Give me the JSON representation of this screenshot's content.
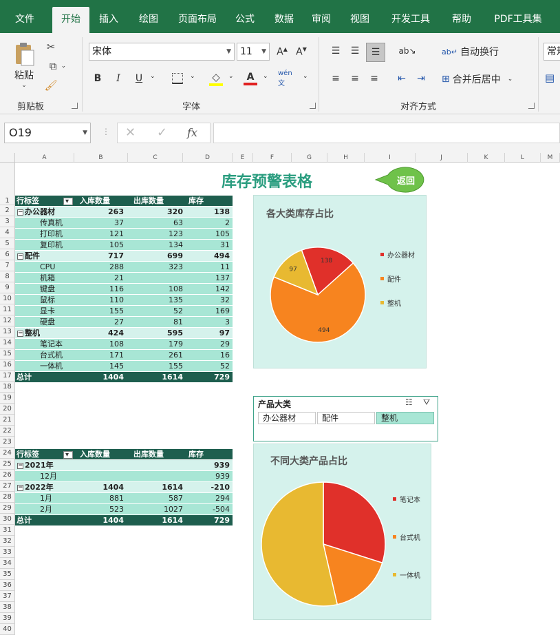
{
  "menu_tabs": [
    "文件",
    "开始",
    "插入",
    "绘图",
    "页面布局",
    "公式",
    "数据",
    "审阅",
    "视图",
    "开发工具",
    "帮助",
    "PDF工具集"
  ],
  "active_tab": "开始",
  "ribbon": {
    "clipboard": {
      "paste_label": "粘贴",
      "group_label": "剪贴板"
    },
    "font": {
      "font_name": "宋体",
      "font_size": "11",
      "group_label": "字体",
      "bold": "B",
      "italic": "I",
      "underline": "U",
      "wen": "wén 文"
    },
    "alignment": {
      "wrap_text": "自动换行",
      "merge_center": "合并后居中",
      "group_label": "对齐方式"
    },
    "number": {
      "format": "常规"
    }
  },
  "formula_bar": {
    "name_box": "O19",
    "fx": "fx",
    "value": ""
  },
  "columns": [
    "A",
    "B",
    "C",
    "D",
    "E",
    "F",
    "G",
    "H",
    "I",
    "J",
    "K",
    "L",
    "M"
  ],
  "rows": [
    "1",
    "2",
    "3",
    "4",
    "5",
    "6",
    "7",
    "8",
    "9",
    "10",
    "11",
    "12",
    "13",
    "14",
    "15",
    "16",
    "17",
    "18",
    "19",
    "20",
    "21",
    "22",
    "23",
    "24",
    "25",
    "26",
    "27",
    "28",
    "29",
    "30",
    "31",
    "32",
    "33",
    "34",
    "35",
    "36",
    "37",
    "38",
    "39",
    "40"
  ],
  "sheet_title": "库存预警表格",
  "back_button": "返回",
  "pivot1": {
    "headers": [
      "行标签",
      "入库数量",
      "出库数量",
      "库存"
    ],
    "rows": [
      {
        "type": "grp",
        "label": "办公器材",
        "in": "263",
        "out": "320",
        "stock": "138"
      },
      {
        "type": "itm",
        "label": "传真机",
        "in": "37",
        "out": "63",
        "stock": "2"
      },
      {
        "type": "itm",
        "label": "打印机",
        "in": "121",
        "out": "123",
        "stock": "105"
      },
      {
        "type": "itm",
        "label": "复印机",
        "in": "105",
        "out": "134",
        "stock": "31"
      },
      {
        "type": "grp",
        "label": "配件",
        "in": "717",
        "out": "699",
        "stock": "494"
      },
      {
        "type": "itm",
        "label": "CPU",
        "in": "288",
        "out": "323",
        "stock": "11"
      },
      {
        "type": "itm",
        "label": "机箱",
        "in": "21",
        "out": "",
        "stock": "137"
      },
      {
        "type": "itm",
        "label": "键盘",
        "in": "116",
        "out": "108",
        "stock": "142"
      },
      {
        "type": "itm",
        "label": "鼠标",
        "in": "110",
        "out": "135",
        "stock": "32"
      },
      {
        "type": "itm",
        "label": "显卡",
        "in": "155",
        "out": "52",
        "stock": "169"
      },
      {
        "type": "itm",
        "label": "硬盘",
        "in": "27",
        "out": "81",
        "stock": "3"
      },
      {
        "type": "grp",
        "label": "整机",
        "in": "424",
        "out": "595",
        "stock": "97"
      },
      {
        "type": "itm",
        "label": "笔记本",
        "in": "108",
        "out": "179",
        "stock": "29"
      },
      {
        "type": "itm",
        "label": "台式机",
        "in": "171",
        "out": "261",
        "stock": "16"
      },
      {
        "type": "itm",
        "label": "一体机",
        "in": "145",
        "out": "155",
        "stock": "52"
      },
      {
        "type": "tot",
        "label": "总计",
        "in": "1404",
        "out": "1614",
        "stock": "729"
      }
    ]
  },
  "pivot2": {
    "headers": [
      "行标签",
      "入库数量",
      "出库数量",
      "库存"
    ],
    "rows": [
      {
        "type": "grp",
        "label": "2021年",
        "in": "",
        "out": "",
        "stock": "939"
      },
      {
        "type": "itm",
        "label": "12月",
        "in": "",
        "out": "",
        "stock": "939"
      },
      {
        "type": "grp",
        "label": "2022年",
        "in": "1404",
        "out": "1614",
        "stock": "-210"
      },
      {
        "type": "itm",
        "label": "1月",
        "in": "881",
        "out": "587",
        "stock": "294"
      },
      {
        "type": "itm",
        "label": "2月",
        "in": "523",
        "out": "1027",
        "stock": "-504"
      },
      {
        "type": "tot",
        "label": "总计",
        "in": "1404",
        "out": "1614",
        "stock": "729"
      }
    ]
  },
  "slicer": {
    "title": "产品大类",
    "items": [
      "办公器材",
      "配件",
      "整机"
    ],
    "selected": "整机"
  },
  "colors": {
    "excel_green": "#217346",
    "pivot_dark": "#1e5e4e",
    "pivot_light": "#d5f2ec",
    "pivot_mid": "#a8e6d5",
    "red": "#e0302a",
    "orange": "#f7841f",
    "gold": "#e8b931"
  },
  "chart_data": [
    {
      "type": "pie",
      "title": "各大类库存占比",
      "categories": [
        "办公器材",
        "配件",
        "整机"
      ],
      "values": [
        138,
        494,
        97
      ],
      "data_labels": [
        "138",
        "494",
        "97"
      ],
      "colors": [
        "#e0302a",
        "#f7841f",
        "#e8b931"
      ],
      "legend": "right"
    },
    {
      "type": "pie",
      "title": "不同大类产品占比",
      "categories": [
        "笔记本",
        "台式机",
        "一体机"
      ],
      "values": [
        29,
        16,
        52
      ],
      "colors": [
        "#e0302a",
        "#f7841f",
        "#e8b931"
      ],
      "legend": "right"
    }
  ]
}
